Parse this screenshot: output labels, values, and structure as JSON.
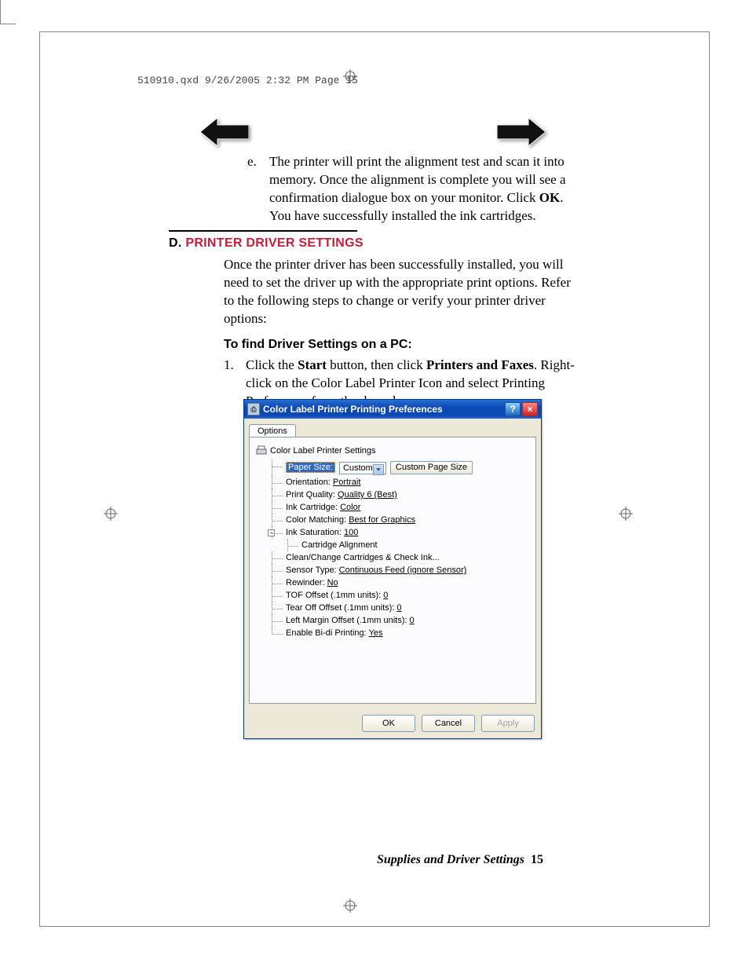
{
  "header_slug": "510910.qxd  9/26/2005  2:32 PM  Page 15",
  "list_e": {
    "marker": "e.",
    "text_before_bold": "The printer will print the alignment test and scan it into memory.  Once the alignment is complete you will see a confirmation dialogue box on your monitor.  Click ",
    "bold": "OK",
    "text_after_bold": ".  You have successfully installed the ink cartridges."
  },
  "section": {
    "prefix": "D. ",
    "title": "PRINTER DRIVER SETTINGS"
  },
  "intro_para": "Once the printer driver has been successfully installed, you will need to set the driver up with the appropriate print options.  Refer to the following steps to change or verify your printer driver options:",
  "subheading": "To find Driver Settings on a PC:",
  "step1": {
    "marker": "1.",
    "pre": "Click the ",
    "b1": "Start",
    "mid": " button, then click ",
    "b2": "Printers and Faxes",
    "post": ". Right-click on the Color Label Printer Icon and select Printing Preferences from the drop-down menu."
  },
  "dialog": {
    "title": "Color Label Printer Printing Preferences",
    "tab": "Options",
    "root": "Color Label Printer Settings",
    "paper_size_label": "Paper Size:",
    "paper_size_value": "Custom",
    "custom_page_btn": "Custom Page Size",
    "items": [
      {
        "label": "Orientation:",
        "value": "Portrait"
      },
      {
        "label": "Print Quality:",
        "value": "Quality 6 (Best)"
      },
      {
        "label": "Ink Cartridge:",
        "value": "Color"
      },
      {
        "label": "Color Matching:",
        "value": "Best for Graphics"
      },
      {
        "label": "Ink Saturation:",
        "value": "100",
        "expandable": true
      },
      {
        "label": "Cartridge Alignment",
        "value": "",
        "sub": true
      },
      {
        "label": "Clean/Change Cartridges & Check Ink...",
        "value": ""
      },
      {
        "label": "Sensor Type:",
        "value": "Continuous Feed (ignore Sensor)"
      },
      {
        "label": "Rewinder:",
        "value": "No"
      },
      {
        "label": "TOF Offset (.1mm units):",
        "value": "0"
      },
      {
        "label": "Tear Off Offset (.1mm units):",
        "value": "0"
      },
      {
        "label": "Left Margin Offset (.1mm units):",
        "value": "0"
      },
      {
        "label": "Enable Bi-di Printing:",
        "value": "Yes"
      }
    ],
    "ok": "OK",
    "cancel": "Cancel",
    "apply": "Apply"
  },
  "footer": {
    "text": "Supplies and Driver Settings",
    "page": "15"
  }
}
